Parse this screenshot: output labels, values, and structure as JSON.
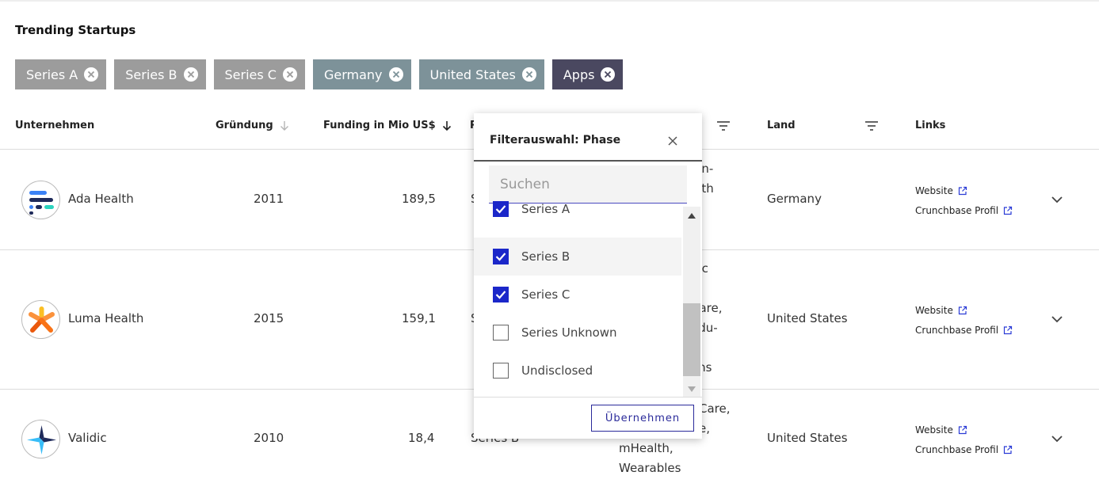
{
  "section_title": "Trending Startups",
  "chips": [
    {
      "label": "Series A",
      "style": "gray"
    },
    {
      "label": "Series B",
      "style": "gray"
    },
    {
      "label": "Series C",
      "style": "gray"
    },
    {
      "label": "Germany",
      "style": "teal"
    },
    {
      "label": "United States",
      "style": "teal"
    },
    {
      "label": "Apps",
      "style": "dark"
    }
  ],
  "table": {
    "headers": {
      "company": "Unternehmen",
      "founded": "Gründung",
      "funding": "Funding in Mio US$",
      "phase": "P",
      "country": "Land",
      "links": "Links"
    },
    "rows": [
      {
        "name": "Ada Health",
        "founded": "2011",
        "funding": "189,5",
        "phase_fragment": "S",
        "category_lines": [
          "l In-",
          "alth"
        ],
        "country": "Germany",
        "website": "Website",
        "crunchbase": "Crunchbase Profil"
      },
      {
        "name": "Luma Health",
        "founded": "2015",
        "funding": "159,1",
        "phase_fragment": "S",
        "category_lines": [
          "nic",
          "",
          "Care,",
          "edu-",
          "",
          "ons"
        ],
        "country": "United States",
        "website": "Website",
        "crunchbase": "Crunchbase Profil"
      },
      {
        "name": "Validic",
        "founded": "2010",
        "funding": "18,4",
        "phase_fragment": "Series B",
        "category_lines": [
          "Care,",
          "e,",
          "mHealth,",
          "Wearables"
        ],
        "country": "United States",
        "website": "Website",
        "crunchbase": "Crunchbase Profil"
      }
    ]
  },
  "filter_popup": {
    "title": "Filterauswahl: Phase",
    "search_placeholder": "Suchen",
    "options": [
      {
        "label": "Series A",
        "checked": true
      },
      {
        "label": "Series B",
        "checked": true
      },
      {
        "label": "Series C",
        "checked": true
      },
      {
        "label": "Series Unknown",
        "checked": false
      },
      {
        "label": "Undisclosed",
        "checked": false
      }
    ],
    "apply_label": "Übernehmen"
  },
  "colors": {
    "chip_gray": "#9c9c9c",
    "chip_teal": "#7d9299",
    "chip_dark": "#4a4860",
    "checkbox_checked": "#1b27c9",
    "link_icon": "#2a3bd6"
  }
}
